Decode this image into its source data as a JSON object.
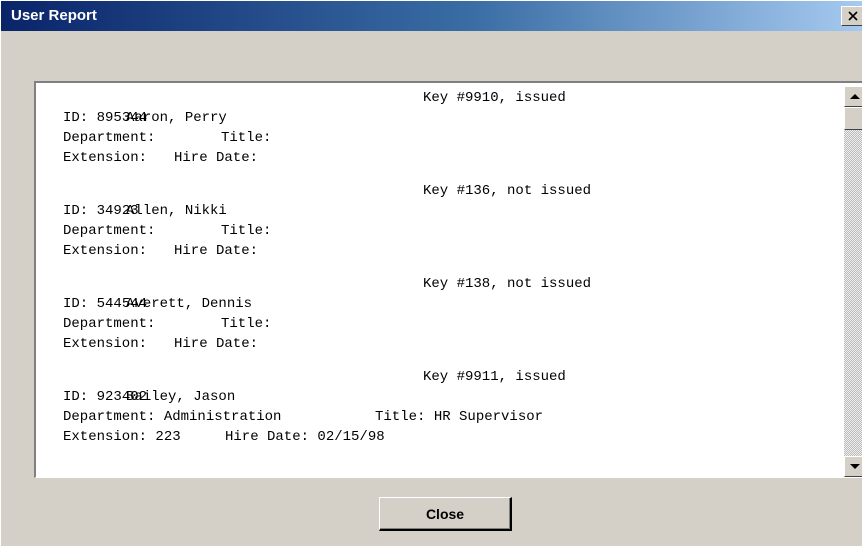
{
  "window": {
    "title": "User Report",
    "close_glyph": "✕"
  },
  "icons": {
    "title_close": "close-icon",
    "scroll_up": "arrow-up-icon",
    "scroll_down": "arrow-down-icon"
  },
  "colors": {
    "titlebar_start": "#0a246a",
    "titlebar_end": "#a6caf0",
    "face": "#d4d0c8",
    "report_bg": "#ffffff"
  },
  "report": {
    "id_label": "ID: ",
    "dept_label": "Department: ",
    "title_label": "Title: ",
    "ext_label": "Extension: ",
    "hire_label": "Hire Date: ",
    "entries": [
      {
        "name": "Aaron, Perry",
        "key": "Key #9910, issued",
        "id": "895344",
        "department": "",
        "title": "",
        "extension": "",
        "hire_date": ""
      },
      {
        "name": "Allen, Nikki",
        "key": "Key #136, not issued",
        "id": "34923",
        "department": "",
        "title": "",
        "extension": "",
        "hire_date": ""
      },
      {
        "name": "Averett, Dennis",
        "key": "Key #138, not issued",
        "id": "544544",
        "department": "",
        "title": "",
        "extension": "",
        "hire_date": ""
      },
      {
        "name": "Bailey, Jason",
        "key": "Key #9911, issued",
        "id": "923402",
        "department": "Administration",
        "title": "HR Supervisor",
        "extension": "223",
        "hire_date": "02/15/98"
      }
    ]
  },
  "footer": {
    "close_label": "Close"
  }
}
